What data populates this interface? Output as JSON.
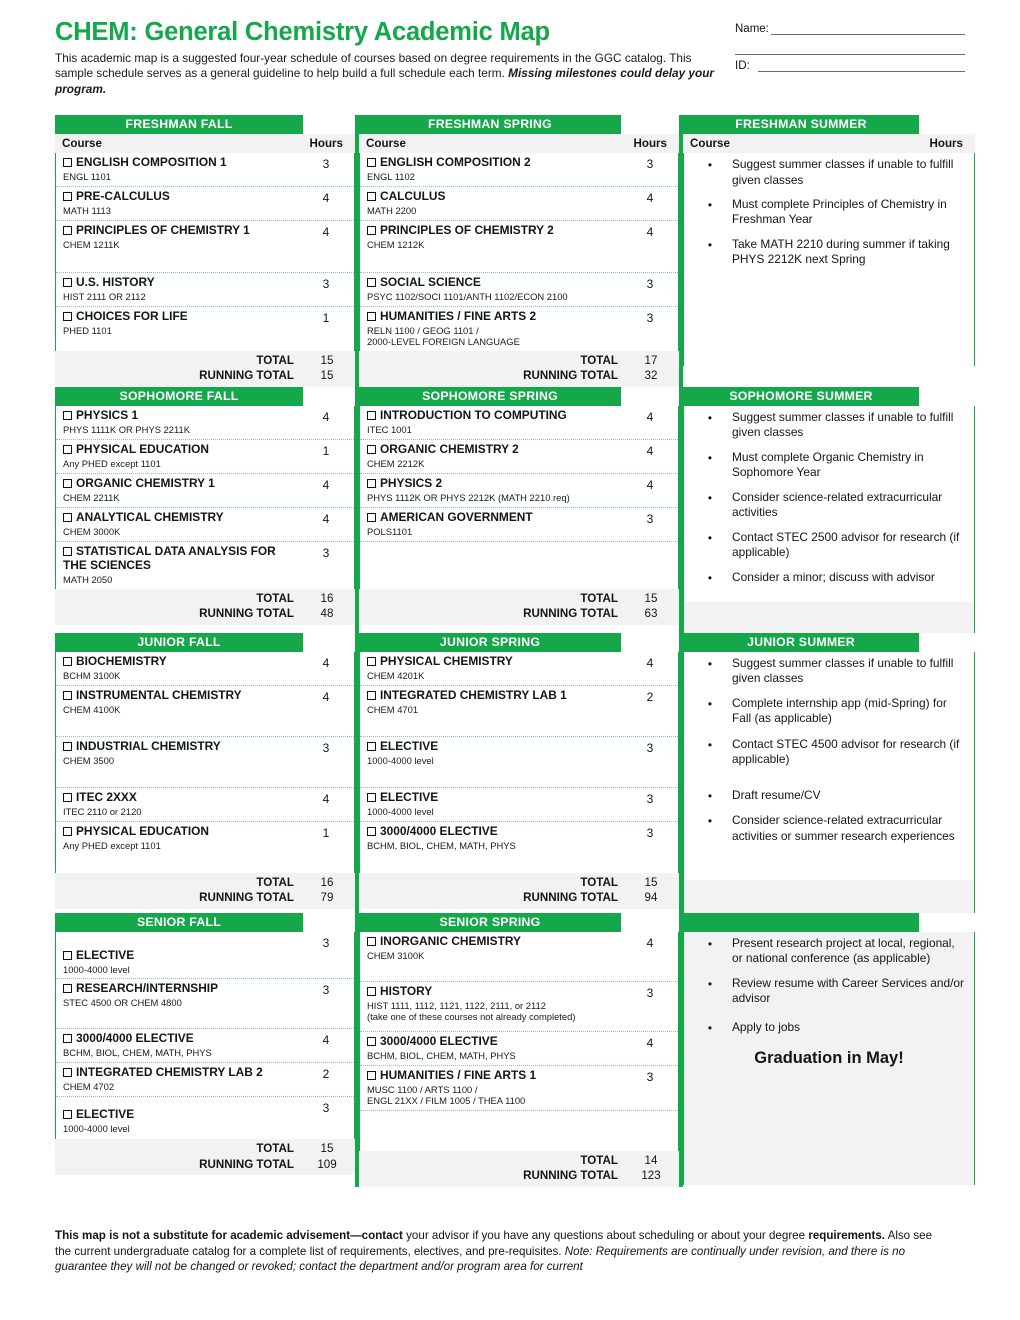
{
  "header": {
    "title": "CHEM: General Chemistry Academic Map",
    "description_part1": "This academic map is a suggested four-year schedule of courses based on degree requirements in the GGC catalog. This sample schedule serves as a general guideline to help build a full schedule each term. ",
    "description_emphasis": "Missing milestones could delay your program.",
    "name_label": "Name:",
    "id_label": "ID:"
  },
  "columns": {
    "course_header": "Course",
    "hours_header": "Hours",
    "total_label": "TOTAL",
    "running_total_label": "RUNNING TOTAL"
  },
  "accent_color": "#14a84a",
  "terms": [
    {
      "name": "FRESHMAN FALL",
      "courses": [
        {
          "title": "ENGLISH COMPOSITION 1",
          "code": "ENGL 1101",
          "hours": "3"
        },
        {
          "title": "PRE-CALCULUS",
          "code": "MATH 1113",
          "hours": "4"
        },
        {
          "title": "PRINCIPLES OF CHEMISTRY 1",
          "code": "CHEM 1211K",
          "hours": "4"
        },
        {
          "title": "U.S. HISTORY",
          "code": "HIST 2111 OR 2112",
          "hours": "3"
        },
        {
          "title": "CHOICES FOR LIFE",
          "code": "PHED 1101",
          "hours": "1"
        }
      ],
      "total": "15",
      "running_total": "15"
    },
    {
      "name": "FRESHMAN SPRING",
      "courses": [
        {
          "title": "ENGLISH COMPOSITION 2",
          "code": "ENGL 1102",
          "hours": "3"
        },
        {
          "title": "CALCULUS",
          "code": "MATH 2200",
          "hours": "4"
        },
        {
          "title": "PRINCIPLES OF CHEMISTRY 2",
          "code": "CHEM 1212K",
          "hours": "4"
        },
        {
          "title": "SOCIAL SCIENCE",
          "code": "PSYC 1102/SOCI 1101/ANTH 1102/ECON 2100",
          "hours": "3"
        },
        {
          "title": "HUMANITIES / FINE ARTS 2",
          "code": "RELN 1100 / GEOG 1101 /\n2000-LEVEL FOREIGN LANGUAGE",
          "hours": "3"
        }
      ],
      "total": "17",
      "running_total": "32"
    },
    {
      "name": "FRESHMAN SUMMER",
      "bullets": [
        "Suggest summer classes if unable to fulfill given classes",
        "Must complete Principles of Chemistry in Freshman Year",
        "Take MATH 2210 during summer if taking PHYS 2212K next Spring"
      ]
    },
    {
      "name": "SOPHOMORE FALL",
      "courses": [
        {
          "title": "PHYSICS 1",
          "code": "PHYS 1111K OR PHYS 2211K",
          "hours": "4"
        },
        {
          "title": "PHYSICAL EDUCATION",
          "code": "Any PHED except 1101",
          "hours": "1"
        },
        {
          "title": "ORGANIC CHEMISTRY 1",
          "code": "CHEM 2211K",
          "hours": "4"
        },
        {
          "title": "ANALYTICAL CHEMISTRY",
          "code": "CHEM 3000K",
          "hours": "4"
        },
        {
          "title": "STATISTICAL DATA ANALYSIS FOR THE SCIENCES",
          "code": "MATH 2050",
          "hours": "3"
        }
      ],
      "total": "16",
      "running_total": "48"
    },
    {
      "name": "SOPHOMORE SPRING",
      "courses": [
        {
          "title": "INTRODUCTION TO COMPUTING",
          "code": "ITEC 1001",
          "hours": "4"
        },
        {
          "title": "ORGANIC CHEMISTRY 2",
          "code": "CHEM 2212K",
          "hours": "4"
        },
        {
          "title": "PHYSICS 2",
          "code": "PHYS 1112K OR PHYS 2212K (MATH 2210 req)",
          "hours": "4"
        },
        {
          "title": "AMERICAN GOVERNMENT",
          "code": "POLS1101",
          "hours": "3"
        },
        {
          "title": "",
          "code": "",
          "hours": ""
        }
      ],
      "total": "15",
      "running_total": "63"
    },
    {
      "name": "SOPHOMORE SUMMER",
      "bullets": [
        "Suggest summer classes if unable to fulfill given classes",
        "Must complete Organic Chemistry in Sophomore Year",
        "Consider science-related extracurricular activities",
        "Contact STEC 2500 advisor for research (if applicable)",
        "Consider a minor; discuss with advisor"
      ]
    },
    {
      "name": "JUNIOR FALL",
      "courses": [
        {
          "title": "BIOCHEMISTRY",
          "code": "BCHM 3100K",
          "hours": "4"
        },
        {
          "title": "INSTRUMENTAL CHEMISTRY",
          "code": "CHEM 4100K",
          "hours": "4"
        },
        {
          "title": "INDUSTRIAL CHEMISTRY",
          "code": "CHEM 3500",
          "hours": "3"
        },
        {
          "title": "ITEC 2XXX",
          "code": "ITEC 2110 or 2120",
          "hours": "4"
        },
        {
          "title": "PHYSICAL EDUCATION",
          "code": "Any PHED except 1101",
          "hours": "1"
        }
      ],
      "total": "16",
      "running_total": "79"
    },
    {
      "name": "JUNIOR SPRING",
      "courses": [
        {
          "title": "PHYSICAL CHEMISTRY",
          "code": "CHEM 4201K",
          "hours": "4"
        },
        {
          "title": "INTEGRATED CHEMISTRY LAB 1",
          "code": "CHEM 4701",
          "hours": "2"
        },
        {
          "title": "ELECTIVE",
          "code": "1000-4000 level",
          "hours": "3"
        },
        {
          "title": "ELECTIVE",
          "code": "1000-4000 level",
          "hours": "3"
        },
        {
          "title": "3000/4000 ELECTIVE",
          "code": "BCHM, BIOL, CHEM, MATH, PHYS",
          "hours": "3"
        }
      ],
      "total": "15",
      "running_total": "94"
    },
    {
      "name": "JUNIOR SUMMER",
      "bullets": [
        "Suggest summer classes if unable to fulfill given classes",
        "Complete internship app (mid-Spring) for Fall (as applicable)",
        "Contact STEC 4500 advisor for research (if applicable)",
        "Draft resume/CV",
        "Consider science-related extracurricular activities or summer research experiences"
      ]
    },
    {
      "name": "SENIOR FALL",
      "courses": [
        {
          "title": "ELECTIVE",
          "code": "1000-4000 level",
          "hours": "3"
        },
        {
          "title": "RESEARCH/INTERNSHIP",
          "code": "STEC 4500 OR CHEM 4800",
          "hours": "3"
        },
        {
          "title": "3000/4000 ELECTIVE",
          "code": "BCHM, BIOL, CHEM, MATH, PHYS",
          "hours": "4"
        },
        {
          "title": "INTEGRATED CHEMISTRY LAB 2",
          "code": "CHEM 4702",
          "hours": "2"
        },
        {
          "title": "ELECTIVE",
          "code": "1000-4000 level",
          "hours": "3"
        }
      ],
      "total": "15",
      "running_total": "109"
    },
    {
      "name": "SENIOR SPRING",
      "courses": [
        {
          "title": "INORGANIC CHEMISTRY",
          "code": "CHEM 3100K",
          "hours": "4"
        },
        {
          "title": "HISTORY",
          "code": "HIST 1111, 1112, 1121, 1122, 2111, or 2112\n(take one of these courses not already completed)",
          "hours": "3"
        },
        {
          "title": "3000/4000 ELECTIVE",
          "code": "BCHM, BIOL, CHEM, MATH, PHYS",
          "hours": "4"
        },
        {
          "title": "HUMANITIES / FINE ARTS 1",
          "code": "MUSC 1100 / ARTS 1100 /\nENGL 21XX / FILM 1005 / THEA 1100",
          "hours": "3"
        },
        {
          "title": "",
          "code": "",
          "hours": ""
        }
      ],
      "total": "14",
      "running_total": "123"
    },
    {
      "name": "",
      "bullets": [
        "Present research project at local, regional, or national conference (as applicable)",
        "Review resume with Career Services and/or advisor",
        "Apply to jobs"
      ],
      "graduation": "Graduation in May!"
    }
  ],
  "footer": {
    "bold1": "This map is not a substitute for academic advisement—contact",
    "normal1": " your advisor if you have any questions about scheduling or about your degree ",
    "bold2": "requirements.",
    "normal2": " Also see the current undergraduate catalog for a complete list of requirements, electives, and pre-requisites. ",
    "italic1": "Note: Requirements are continually under revision, and there is no guarantee they will not be changed or revoked; contact the department and/or program area for current"
  }
}
